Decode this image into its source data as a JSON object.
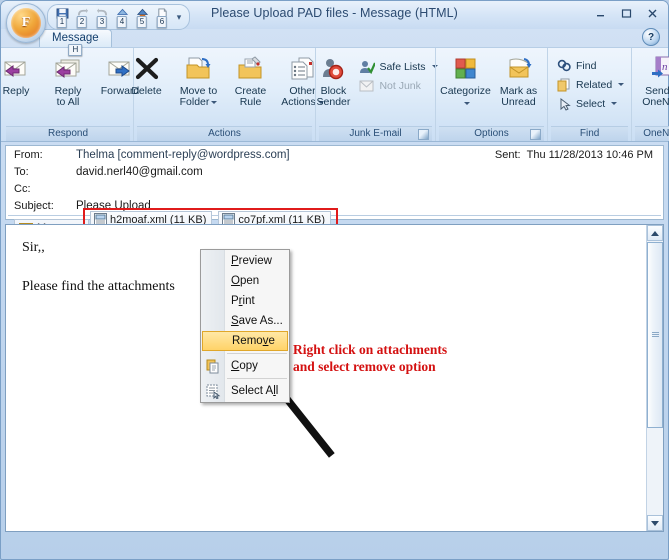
{
  "window": {
    "title": "Please Upload PAD files - Message (HTML)",
    "minimize": "–",
    "maximize": "□",
    "close": "X",
    "orb_letter": "F",
    "help": "?"
  },
  "quick_access": {
    "keytips": [
      "1",
      "2",
      "3",
      "4",
      "5",
      "6"
    ],
    "items": [
      {
        "name": "save-icon",
        "keytip": "1"
      },
      {
        "name": "undo-icon",
        "keytip": "2"
      },
      {
        "name": "redo-icon",
        "keytip": "3"
      },
      {
        "name": "previous-item-icon",
        "keytip": "4"
      },
      {
        "name": "next-item-icon",
        "keytip": "5"
      },
      {
        "name": "print-preview-icon",
        "keytip": "6"
      }
    ],
    "overflow": "▾"
  },
  "tabs": [
    {
      "label": "Message",
      "keytip": "H",
      "active": true
    }
  ],
  "ribbon": {
    "groups": [
      {
        "label": "Respond",
        "buttons": [
          {
            "label": "Reply",
            "icon": "reply-icon"
          },
          {
            "label": "Reply\nto All",
            "line1": "Reply",
            "line2": "to All",
            "icon": "reply-all-icon"
          },
          {
            "label": "Forward",
            "icon": "forward-icon"
          }
        ]
      },
      {
        "label": "Actions",
        "buttons": [
          {
            "label": "Delete",
            "icon": "delete-icon"
          },
          {
            "line1": "Move to",
            "line2": "Folder",
            "icon": "move-to-folder-icon",
            "dropdown": true
          },
          {
            "line1": "Create",
            "line2": "Rule",
            "icon": "create-rule-icon"
          },
          {
            "line1": "Other",
            "line2": "Actions",
            "icon": "other-actions-icon",
            "dropdown": true
          }
        ]
      },
      {
        "label": "Junk E-mail",
        "has_dialog_launcher": true,
        "buttons": [
          {
            "line1": "Block",
            "line2": "Sender",
            "icon": "block-sender-icon"
          }
        ],
        "small_buttons": [
          {
            "label": "Safe Lists",
            "icon": "safe-lists-icon",
            "dropdown": true,
            "disabled": false
          },
          {
            "label": "Not Junk",
            "icon": "not-junk-icon",
            "dropdown": false,
            "disabled": true
          }
        ]
      },
      {
        "label": "Options",
        "has_dialog_launcher": true,
        "buttons": [
          {
            "label": "Categorize",
            "icon": "categorize-icon",
            "dropdown": true
          },
          {
            "line1": "Mark as",
            "line2": "Unread",
            "icon": "mark-unread-icon"
          }
        ]
      },
      {
        "label": "Find",
        "small_buttons": [
          {
            "label": "Find",
            "icon": "find-icon",
            "dropdown": false
          },
          {
            "label": "Related",
            "icon": "related-icon",
            "dropdown": true
          },
          {
            "label": "Select",
            "icon": "select-icon",
            "dropdown": true
          }
        ]
      },
      {
        "label": "OneNote",
        "buttons": [
          {
            "line1": "Send to",
            "line2": "OneNote",
            "icon": "send-to-onenote-icon"
          }
        ]
      }
    ]
  },
  "header": {
    "from_label": "From:",
    "from_value": "Thelma [comment-reply@wordpress.com]",
    "to_label": "To:",
    "to_value": "david.nerl40@gmail.com",
    "cc_label": "Cc:",
    "cc_value": "",
    "subject_label": "Subject:",
    "subject_value": "Please Upload",
    "sent_label": "Sent:",
    "sent_value": "Thu 11/28/2013 10:46 PM"
  },
  "attachments": {
    "message_chip": "Message",
    "highlight_color": "#e01b1b",
    "files": [
      {
        "name": "h2moaf.xml (11 KB)"
      },
      {
        "name": "co7pf.xml (11 KB)"
      }
    ]
  },
  "body": {
    "paragraphs": [
      "Sir,,",
      "Please find the attachments"
    ]
  },
  "context_menu": {
    "items": [
      {
        "label": "Preview",
        "underline_index": 0,
        "icon": null,
        "highlighted": false
      },
      {
        "label": "Open",
        "underline_index": 0,
        "icon": null,
        "highlighted": false
      },
      {
        "label": "Print",
        "underline_index": 1,
        "icon": null,
        "highlighted": false
      },
      {
        "label": "Save As...",
        "underline_index": 0,
        "icon": null,
        "highlighted": false
      },
      {
        "label": "Remove",
        "underline_index": 4,
        "icon": null,
        "highlighted": true
      },
      {
        "label": "Copy",
        "underline_index": 0,
        "icon": "copy-icon",
        "highlighted": false
      },
      {
        "label": "Select All",
        "underline_index": 8,
        "icon": "select-all-icon",
        "highlighted": false
      }
    ],
    "highlight_fill": "#ffd368"
  },
  "annotation": {
    "line1": "Right click on attachments",
    "line2": "and select remove option",
    "color": "#d41111"
  }
}
